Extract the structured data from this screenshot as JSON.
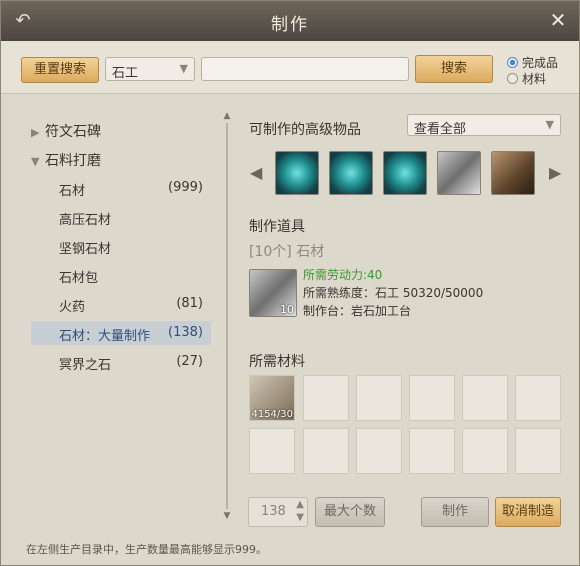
{
  "window": {
    "title": "制作"
  },
  "toolbar": {
    "reset_label": "重置搜索",
    "category_value": "石工",
    "search_label": "搜索",
    "radio_finished": "完成品",
    "radio_material": "材料"
  },
  "sidebar": {
    "categories": [
      {
        "label": "符文石碑",
        "expanded": false
      },
      {
        "label": "石料打磨",
        "expanded": true
      }
    ],
    "items": [
      {
        "label": "石材",
        "count": "(999)"
      },
      {
        "label": "高压石材",
        "count": ""
      },
      {
        "label": "坚钢石材",
        "count": ""
      },
      {
        "label": "石材包",
        "count": ""
      },
      {
        "label": "火药",
        "count": "(81)"
      },
      {
        "label": "石材：大量制作",
        "count": "(138)"
      },
      {
        "label": "冥界之石",
        "count": "(27)"
      }
    ]
  },
  "advanced": {
    "label": "可制作的高级物品",
    "filter_value": "查看全部"
  },
  "tool": {
    "label": "制作道具",
    "product_name": "[10个] 石材",
    "product_qty": "10",
    "labor": "所需劳动力:40",
    "proficiency": "所需熟练度：石工 50320/50000",
    "station": "制作台：岩石加工台"
  },
  "materials": {
    "label": "所需材料",
    "first_qty": "4154/30"
  },
  "bottom": {
    "quantity": "138",
    "max_label": "最大个数",
    "make_label": "制作",
    "cancel_label": "取消制造"
  },
  "hint": "在左侧生产目录中，生产数量最高能够显示999。",
  "colors": {
    "accent_orange": "#dcaa5e",
    "labor_green": "#3a9a2a",
    "selected_blue": "#2f4f7a"
  }
}
